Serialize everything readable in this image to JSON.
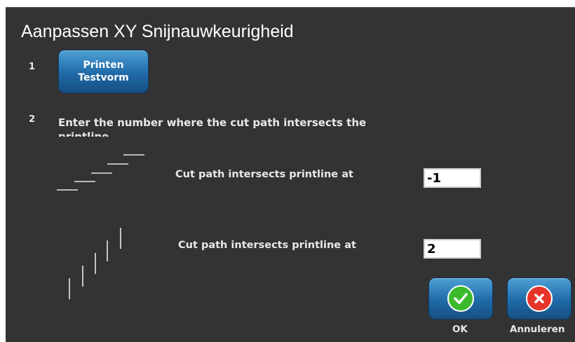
{
  "dialog": {
    "title": "Aanpassen XY Snijnauwkeurigheid"
  },
  "step1": {
    "number": "1",
    "button_line1": "Printen",
    "button_line2": "Testvorm"
  },
  "step2": {
    "number": "2",
    "instruction": "Enter the number where the cut path intersects the printline"
  },
  "x_adjust": {
    "label": "Cut path intersects printline at",
    "value": "-1",
    "pattern_icon": "horizontal-staircase-lines-icon"
  },
  "y_adjust": {
    "label": "Cut path intersects printline at",
    "value": "2",
    "pattern_icon": "vertical-staircase-lines-icon"
  },
  "actions": {
    "ok_label": "OK",
    "cancel_label": "Annuleren",
    "ok_icon": "checkmark-icon",
    "cancel_icon": "x-close-icon"
  },
  "colors": {
    "dialog_background": "#333333",
    "button_blue": "#1f6aa8",
    "ok_green": "#3cba2e",
    "cancel_red": "#e5352a"
  }
}
